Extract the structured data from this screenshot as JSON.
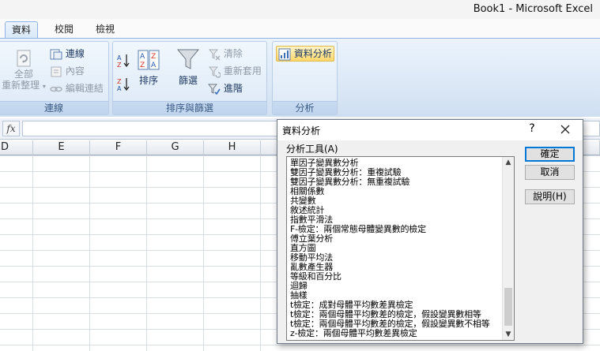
{
  "window": {
    "title": "Book1 - Microsoft Excel"
  },
  "ribbon_tabs": [
    {
      "label": "資料",
      "active": true
    },
    {
      "label": "校閱",
      "active": false
    },
    {
      "label": "檢視",
      "active": false
    }
  ],
  "ribbon": {
    "connections_group": {
      "label": "連線",
      "refresh_all_line1": "全部",
      "refresh_all_line2": "重新整理",
      "connections": "連線",
      "properties": "內容",
      "edit_links": "編輯連結"
    },
    "sort_filter_group": {
      "label": "排序與篩選",
      "sort": "排序",
      "filter": "篩選",
      "clear": "清除",
      "reapply": "重新套用",
      "advanced": "進階"
    },
    "analysis_group": {
      "label": "分析",
      "data_analysis": "資料分析"
    }
  },
  "formula_bar": {
    "fx": "fx",
    "value": ""
  },
  "columns": [
    "D",
    "E",
    "F",
    "G",
    "H"
  ],
  "dialog": {
    "title": "資料分析",
    "help_glyph": "?",
    "tools_label": "分析工具(A)",
    "tools": [
      "單因子變異數分析",
      "雙因子變異數分析：重複試驗",
      "雙因子變異數分析：無重複試驗",
      "相關係數",
      "共變數",
      "敘述統計",
      "指數平滑法",
      "F-檢定：兩個常態母體變異數的檢定",
      "傅立葉分析",
      "直方圖",
      "移動平均法",
      "亂數產生器",
      "等級和百分比",
      "迴歸",
      "抽樣",
      "t檢定：成對母體平均數差異檢定",
      "t檢定：兩個母體平均數差的檢定，假設變異數相等",
      "t檢定：兩個母體平均數差的檢定，假設變異數不相等",
      "z-檢定：兩個母體平均數差異檢定"
    ],
    "ok_label": "確定",
    "cancel_label": "取消",
    "help_label": "說明(H)"
  }
}
